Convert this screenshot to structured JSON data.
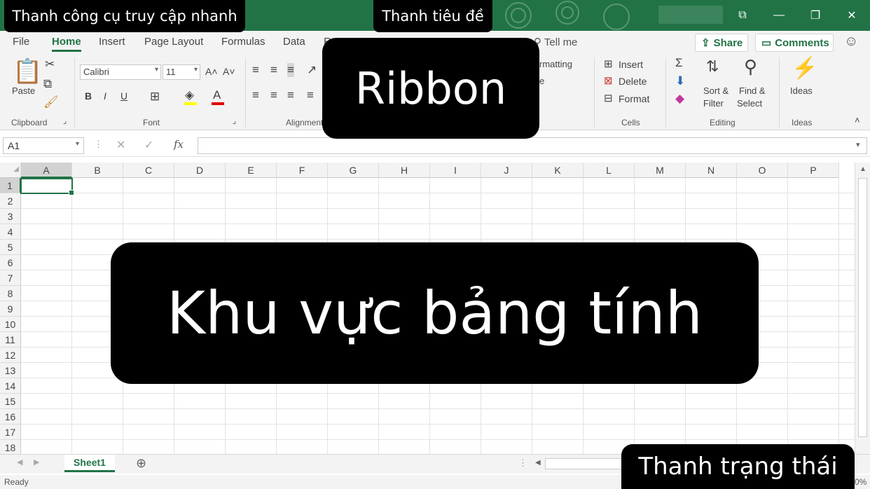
{
  "window": {
    "controls": [
      "display-options",
      "minimize",
      "restore",
      "close"
    ]
  },
  "menu": {
    "tabs": [
      "File",
      "Home",
      "Insert",
      "Page Layout",
      "Formulas",
      "Data",
      "R"
    ],
    "active": "Home",
    "tell_me": "Tell me",
    "share": "Share",
    "comments": "Comments"
  },
  "ribbon": {
    "clipboard": {
      "paste": "Paste",
      "label": "Clipboard"
    },
    "font": {
      "name": "Calibri",
      "size": "11",
      "bold": "B",
      "italic": "I",
      "underline": "U",
      "grow": "A˄",
      "shrink": "A˅",
      "label": "Font"
    },
    "alignment": {
      "label": "Alignment"
    },
    "styles": {
      "conditional_partial": "rmatting",
      "partial2": "e"
    },
    "cells": {
      "insert": "Insert",
      "delete": "Delete",
      "format": "Format",
      "label": "Cells"
    },
    "editing": {
      "sort": "Sort &",
      "filter": "Filter",
      "find": "Find &",
      "select": "Select",
      "label": "Editing"
    },
    "ideas": {
      "button": "Ideas",
      "label": "Ideas"
    }
  },
  "formula_bar": {
    "name_box": "A1",
    "fx": "fx",
    "value": ""
  },
  "grid": {
    "columns": [
      "A",
      "B",
      "C",
      "D",
      "E",
      "F",
      "G",
      "H",
      "I",
      "J",
      "K",
      "L",
      "M",
      "N",
      "O",
      "P"
    ],
    "rows": [
      "1",
      "2",
      "3",
      "4",
      "5",
      "6",
      "7",
      "8",
      "9",
      "10",
      "11",
      "12",
      "13",
      "14",
      "15",
      "16",
      "17",
      "18"
    ],
    "selected_cell": "A1"
  },
  "sheets": {
    "tabs": [
      "Sheet1"
    ],
    "active": "Sheet1"
  },
  "status": {
    "text": "Ready",
    "zoom_partial": "0%"
  },
  "overlays": {
    "quick_access": "Thanh công cụ truy cập nhanh",
    "title_bar": "Thanh tiêu đề",
    "ribbon": "Ribbon",
    "sheet_area": "Khu vực bảng tính",
    "status_bar": "Thanh trạng thái"
  },
  "colors": {
    "brand": "#217346",
    "ribbon_bg": "#f3f3f3",
    "overlay": "#000000"
  }
}
